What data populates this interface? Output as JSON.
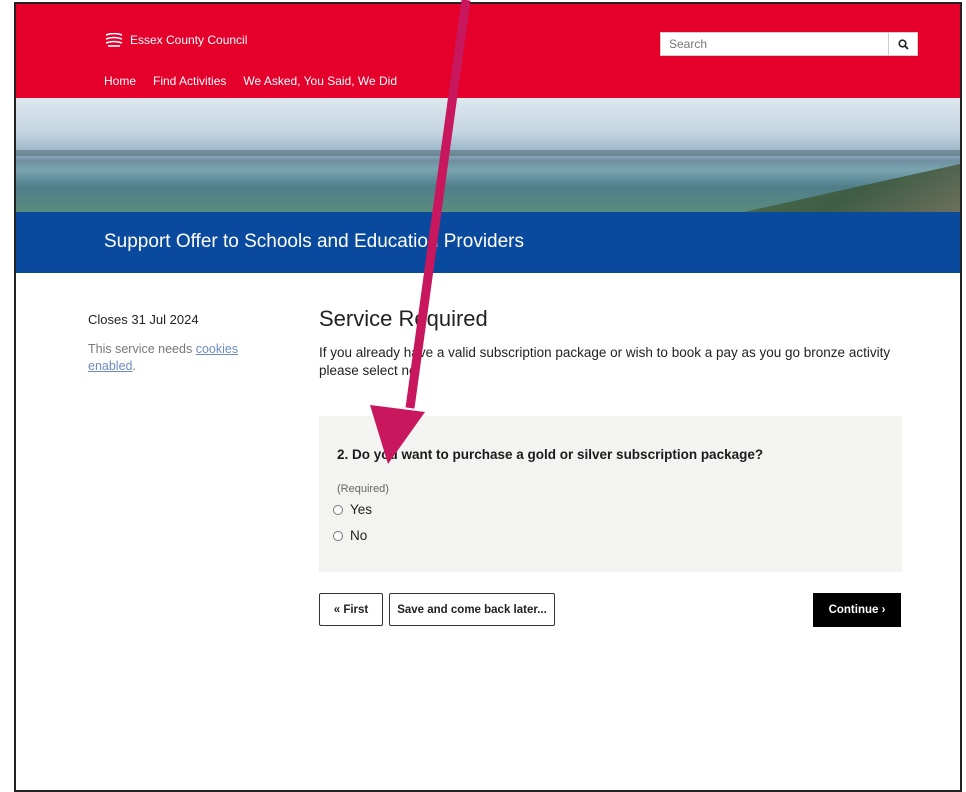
{
  "header": {
    "logo_text": "Essex County Council",
    "nav": [
      "Home",
      "Find Activities",
      "We Asked, You Said, We Did"
    ],
    "search_placeholder": "Search"
  },
  "page": {
    "title": "Support Offer to Schools and Education Providers"
  },
  "sidebar": {
    "closes": "Closes 31 Jul 2024",
    "cookies_prefix": "This service needs ",
    "cookies_link": "cookies enabled",
    "cookies_suffix": "."
  },
  "main": {
    "heading": "Service Required",
    "intro": "If you already have a valid subscription package or wish to book a pay as you go bronze activity please select no."
  },
  "question": {
    "text": "2. Do you want to purchase a gold or silver subscription package?",
    "required": "(Required)",
    "options": [
      "Yes",
      "No"
    ]
  },
  "buttons": {
    "first": "« First",
    "save": "Save and come back later...",
    "continue": "Continue ›"
  },
  "colors": {
    "header_red": "#e4002b",
    "title_blue": "#0a4a9e",
    "annotation_arrow": "#c8175d"
  }
}
